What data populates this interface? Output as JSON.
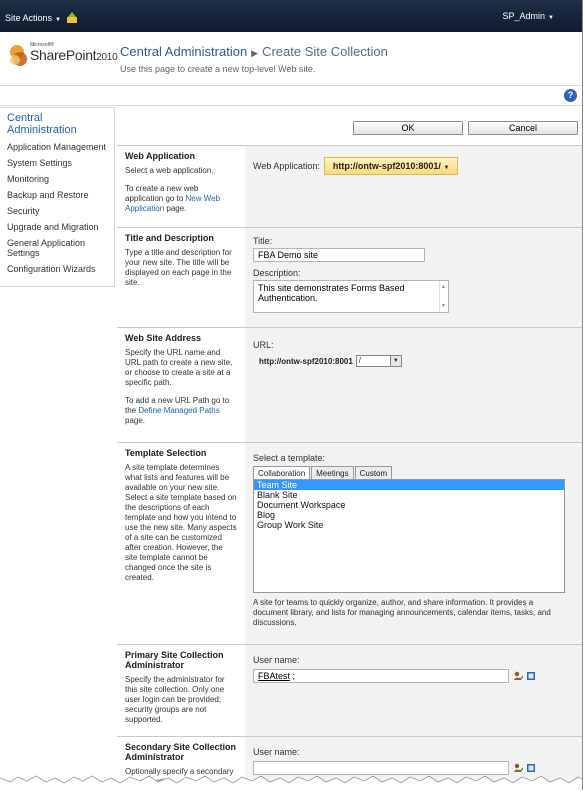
{
  "ribbon": {
    "site_actions": "Site Actions",
    "user": "SP_Admin"
  },
  "header": {
    "logo_small": "Microsoft®",
    "logo_main": "SharePoint",
    "logo_year": "2010",
    "crumb_root": "Central Administration",
    "crumb_current": "Create Site Collection",
    "subtitle": "Use this page to create a new top-level Web site."
  },
  "leftnav": {
    "heading": "Central Administration",
    "items": [
      "Application Management",
      "System Settings",
      "Monitoring",
      "Backup and Restore",
      "Security",
      "Upgrade and Migration",
      "General Application Settings",
      "Configuration Wizards"
    ]
  },
  "buttons": {
    "ok": "OK",
    "cancel": "Cancel"
  },
  "web_app": {
    "title": "Web Application",
    "desc1": "Select a web application.",
    "desc2_pre": "To create a new web application go to ",
    "desc2_link": "New Web Application",
    "desc2_post": " page.",
    "label": "Web Application:",
    "value": "http://ontw-spf2010:8001/"
  },
  "title_desc": {
    "title": "Title and Description",
    "desc": "Type a title and description for your new site. The title will be displayed on each page in the site.",
    "title_label": "Title:",
    "title_value": "FBA Demo site",
    "desc_label": "Description:",
    "desc_value": "This site demonstrates Forms Based Authentication."
  },
  "address": {
    "title": "Web Site Address",
    "desc1": "Specify the URL name and URL path to create a new site, or choose to create a site at a specific path.",
    "desc2_pre": "To add a new URL Path go to the ",
    "desc2_link": "Define Managed Paths",
    "desc2_post": " page.",
    "url_label": "URL:",
    "url_base": "http://ontw-spf2010:8001",
    "url_path": "/"
  },
  "template": {
    "title": "Template Selection",
    "desc": "A site template determines what lists and features will be available on your new site. Select a site template based on the descriptions of each template and how you intend to use the new site. Many aspects of a site can be customized after creation. However, the site template cannot be changed once the site is created.",
    "select_label": "Select a template:",
    "tabs": [
      "Collaboration",
      "Meetings",
      "Custom"
    ],
    "items": [
      "Team Site",
      "Blank Site",
      "Document Workspace",
      "Blog",
      "Group Work Site"
    ],
    "selected_desc": "A site for teams to quickly organize, author, and share information. It provides a document library, and lists for managing announcements, calendar items, tasks, and discussions."
  },
  "primary_admin": {
    "title": "Primary Site Collection Administrator",
    "desc": "Specify the administrator for this site collection. Only one user login can be provided; security groups are not supported.",
    "user_label": "User name:",
    "user_value": "FBAtest",
    "user_suffix": " ;"
  },
  "secondary_admin": {
    "title": "Secondary Site Collection Administrator",
    "desc": "Optionally specify a secondary site collection",
    "user_label": "User name:"
  }
}
